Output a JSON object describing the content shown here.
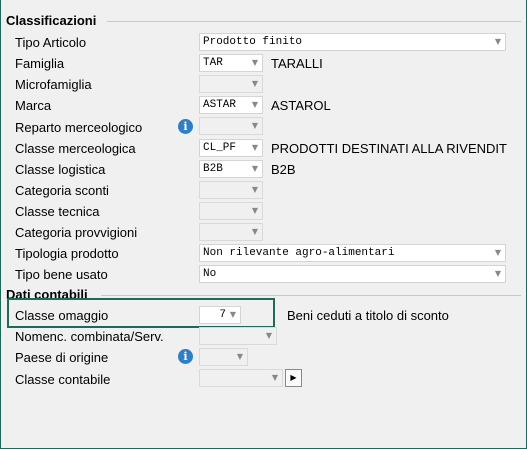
{
  "sections": {
    "classificazioni": "Classificazioni",
    "dati_contabili": "Dati contabili"
  },
  "fields": {
    "tipo_articolo": {
      "label": "Tipo Articolo",
      "value": "Prodotto finito"
    },
    "famiglia": {
      "label": "Famiglia",
      "code": "TAR",
      "desc": "TARALLI"
    },
    "microfamiglia": {
      "label": "Microfamiglia",
      "code": ""
    },
    "marca": {
      "label": "Marca",
      "code": "ASTAR",
      "desc": "ASTAROL"
    },
    "reparto": {
      "label": "Reparto merceologico",
      "code": ""
    },
    "classe_merceologica": {
      "label": "Classe merceologica",
      "code": "CL_PF",
      "desc": "PRODOTTI DESTINATI ALLA RIVENDIT"
    },
    "classe_logistica": {
      "label": "Classe logistica",
      "code": "B2B",
      "desc": "B2B"
    },
    "categoria_sconti": {
      "label": "Categoria sconti",
      "code": ""
    },
    "classe_tecnica": {
      "label": "Classe tecnica",
      "code": ""
    },
    "categoria_provvigioni": {
      "label": "Categoria provvigioni",
      "code": ""
    },
    "tipologia_prodotto": {
      "label": "Tipologia prodotto",
      "value": "Non rilevante agro-alimentari"
    },
    "tipo_bene_usato": {
      "label": "Tipo bene usato",
      "value": "No"
    },
    "classe_omaggio": {
      "label": "Classe omaggio",
      "code": "7",
      "desc": "Beni ceduti a titolo di sconto"
    },
    "nomenc": {
      "label": "Nomenc. combinata/Serv.",
      "code": ""
    },
    "paese_origine": {
      "label": "Paese di origine",
      "code": ""
    },
    "classe_contabile": {
      "label": "Classe contabile",
      "code": ""
    }
  },
  "icons": {
    "info": "i",
    "arrow": "▼",
    "go": "▶"
  }
}
